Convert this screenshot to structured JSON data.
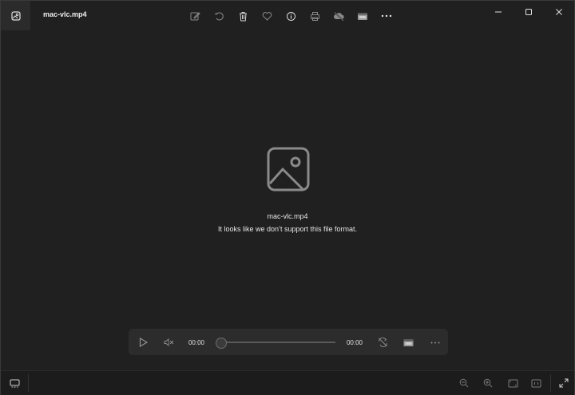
{
  "window": {
    "file_name": "mac-vlc.mp4"
  },
  "toolbar": {
    "icons": [
      "edit-icon",
      "rotate-icon",
      "delete-icon",
      "favorite-icon",
      "info-icon",
      "print-icon",
      "cloud-off-icon",
      "video-editor-icon",
      "more-icon"
    ]
  },
  "content": {
    "file_name": "mac-vlc.mp4",
    "message": "It looks like we don’t support this file format."
  },
  "player": {
    "current_time": "00:00",
    "total_time": "00:00",
    "progress": 0
  },
  "colors": {
    "background": "#202020",
    "player_bg": "#2c2c2c",
    "text": "#e6e6e6"
  }
}
